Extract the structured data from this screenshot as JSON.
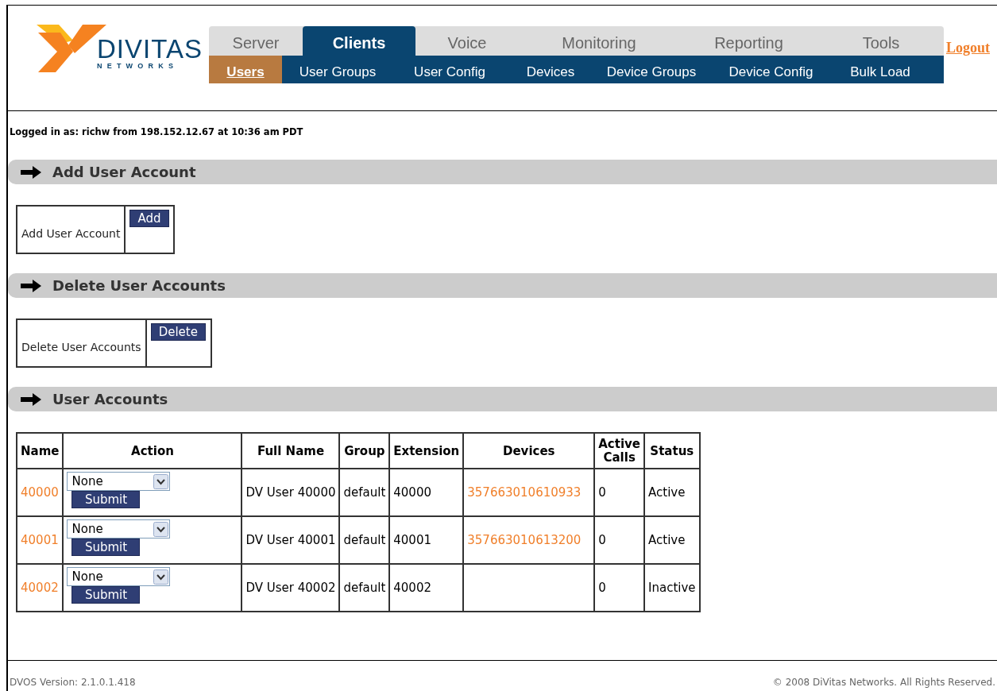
{
  "logo": {
    "name": "DIVITAS",
    "tagline": "NETWORKS"
  },
  "tabs": [
    {
      "label": "Server",
      "selected": false
    },
    {
      "label": "Clients",
      "selected": true
    },
    {
      "label": "Voice",
      "selected": false
    },
    {
      "label": "Monitoring",
      "selected": false
    },
    {
      "label": "Reporting",
      "selected": false
    },
    {
      "label": "Tools",
      "selected": false
    }
  ],
  "subtabs": [
    {
      "label": "Users",
      "selected": true
    },
    {
      "label": "User Groups",
      "selected": false
    },
    {
      "label": "User Config",
      "selected": false
    },
    {
      "label": "Devices",
      "selected": false
    },
    {
      "label": "Device Groups",
      "selected": false
    },
    {
      "label": "Device Config",
      "selected": false
    },
    {
      "label": "Bulk Load",
      "selected": false
    }
  ],
  "logout": "Logout",
  "login_info": "Logged in as: richw from 198.152.12.67 at 10:36 am PDT",
  "sections": [
    {
      "kind": "action",
      "title": "Add User Account",
      "label": "Add User Account",
      "button": "Add"
    },
    {
      "kind": "action",
      "title": "Delete User Accounts",
      "label": "Delete User Accounts",
      "button": "Delete"
    },
    {
      "kind": "table",
      "title": "User Accounts"
    }
  ],
  "table": {
    "columns": [
      "Name",
      "Action",
      "Full Name",
      "Group",
      "Extension",
      "Devices",
      "Active Calls",
      "Status"
    ],
    "rows": [
      {
        "name": "40000",
        "action": "None",
        "button": "Submit",
        "full_name": "DV User 40000",
        "group": "default",
        "extension": "40000",
        "devices": "357663010610933",
        "active_calls": "0",
        "status": "Active"
      },
      {
        "name": "40001",
        "action": "None",
        "button": "Submit",
        "full_name": "DV User 40001",
        "group": "default",
        "extension": "40001",
        "devices": "357663010613200",
        "active_calls": "0",
        "status": "Active"
      },
      {
        "name": "40002",
        "action": "None",
        "button": "Submit",
        "full_name": "DV User 40002",
        "group": "default",
        "extension": "40002",
        "active_calls": "0",
        "status": "Inactive"
      }
    ]
  },
  "footer": {
    "version": "DVOS Version: 2.1.0.1.418",
    "copyright": "© 2008 DiVitas Networks. All Rights Reserved."
  }
}
